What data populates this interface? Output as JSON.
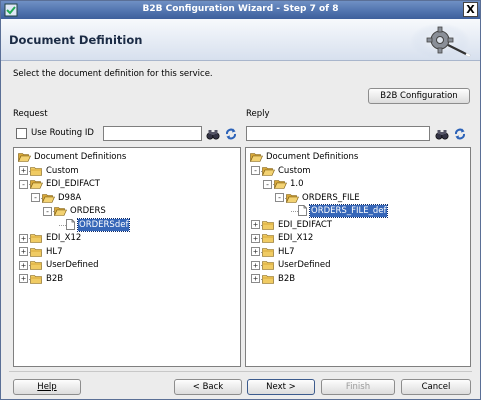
{
  "window": {
    "title": "B2B Configuration Wizard - Step 7 of 8",
    "close_glyph": "X"
  },
  "header": {
    "title": "Document Definition"
  },
  "instruction": "Select the document definition for this service.",
  "b2b_config_button": "B2B Configuration",
  "request": {
    "label": "Request",
    "routing_checkbox_label": "Use Routing ID",
    "routing_checked": false,
    "routing_value": "",
    "tree": [
      {
        "label": "Document Definitions",
        "level": 0,
        "type": "folder-open",
        "expander": ""
      },
      {
        "label": "Custom",
        "level": 1,
        "type": "folder",
        "expander": "+"
      },
      {
        "label": "EDI_EDIFACT",
        "level": 1,
        "type": "folder-open",
        "expander": "-"
      },
      {
        "label": "D98A",
        "level": 2,
        "type": "folder-open",
        "expander": "-"
      },
      {
        "label": "ORDERS",
        "level": 3,
        "type": "folder-open",
        "expander": "-"
      },
      {
        "label": "ORDERSdef",
        "level": 4,
        "type": "doc",
        "expander": "",
        "selected": true
      },
      {
        "label": "EDI_X12",
        "level": 1,
        "type": "folder",
        "expander": "+"
      },
      {
        "label": "HL7",
        "level": 1,
        "type": "folder",
        "expander": "+"
      },
      {
        "label": "UserDefined",
        "level": 1,
        "type": "folder",
        "expander": "+"
      },
      {
        "label": "B2B",
        "level": 1,
        "type": "folder",
        "expander": "+"
      }
    ]
  },
  "reply": {
    "label": "Reply",
    "routing_value": "",
    "tree": [
      {
        "label": "Document Definitions",
        "level": 0,
        "type": "folder-open",
        "expander": ""
      },
      {
        "label": "Custom",
        "level": 1,
        "type": "folder-open",
        "expander": "-"
      },
      {
        "label": "1.0",
        "level": 2,
        "type": "folder-open",
        "expander": "-"
      },
      {
        "label": "ORDERS_FILE",
        "level": 3,
        "type": "folder-open",
        "expander": "-"
      },
      {
        "label": "ORDERS_FILE_def",
        "level": 4,
        "type": "doc",
        "expander": "",
        "selected": true
      },
      {
        "label": "EDI_EDIFACT",
        "level": 1,
        "type": "folder",
        "expander": "+"
      },
      {
        "label": "EDI_X12",
        "level": 1,
        "type": "folder",
        "expander": "+"
      },
      {
        "label": "HL7",
        "level": 1,
        "type": "folder",
        "expander": "+"
      },
      {
        "label": "UserDefined",
        "level": 1,
        "type": "folder",
        "expander": "+"
      },
      {
        "label": "B2B",
        "level": 1,
        "type": "folder",
        "expander": "+"
      }
    ]
  },
  "footer": {
    "help": "Help",
    "back": "< Back",
    "next": "Next >",
    "finish": "Finish",
    "cancel": "Cancel"
  },
  "colors": {
    "titlebar": "#4f72ad",
    "selection": "#3767b8",
    "folder": "#e8c25a"
  }
}
